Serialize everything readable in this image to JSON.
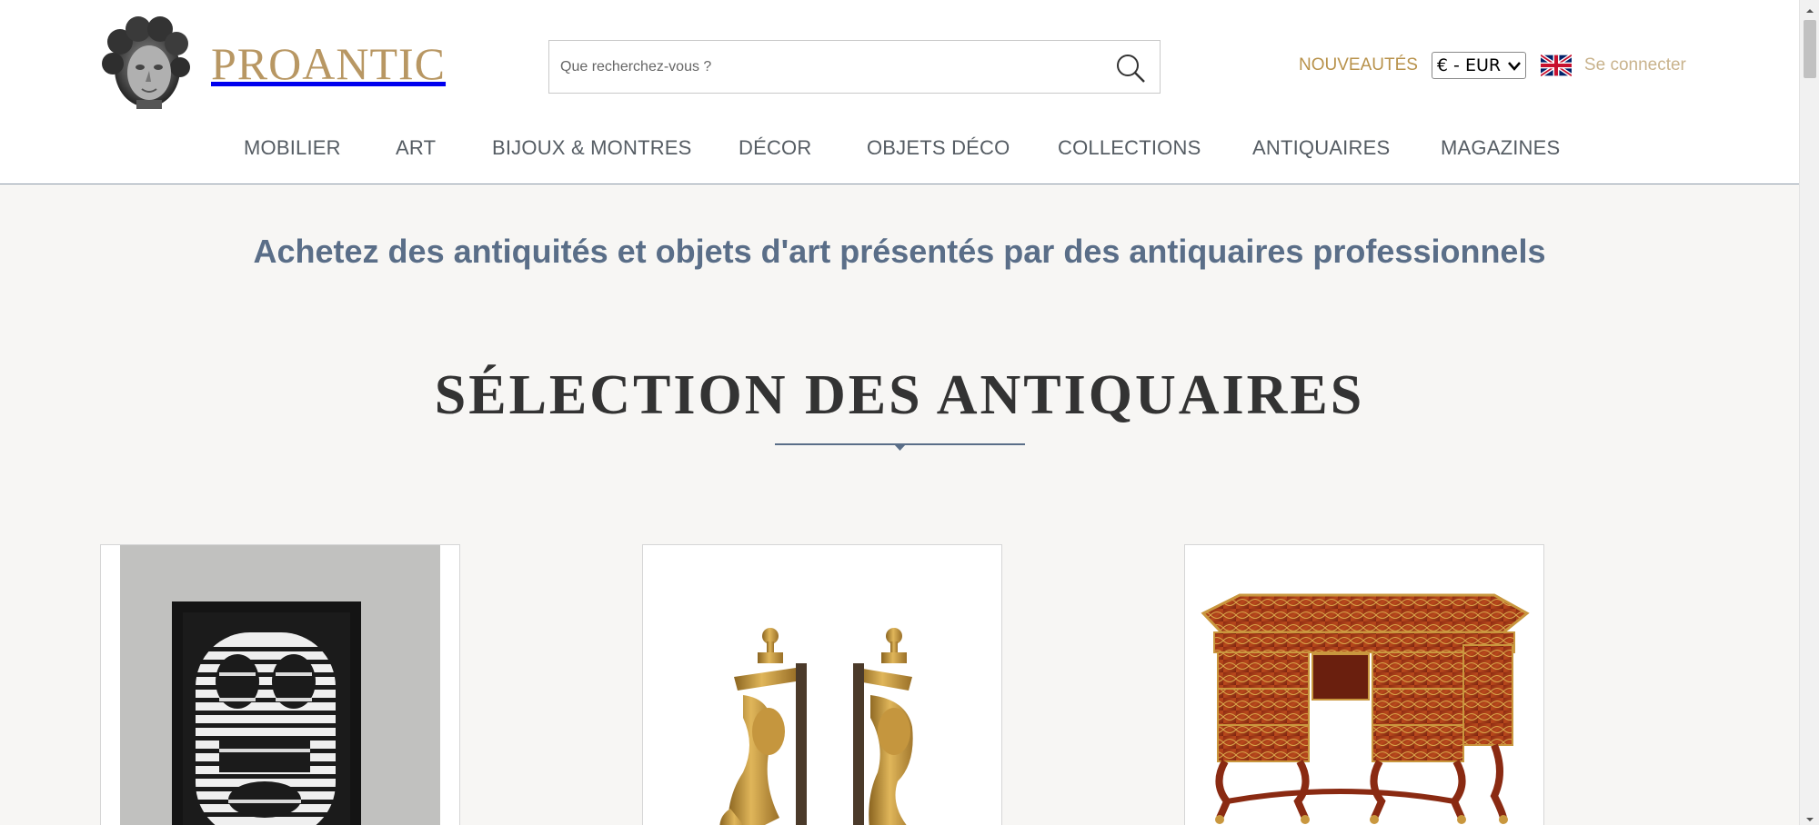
{
  "site": {
    "name": "PROANTIC"
  },
  "search": {
    "placeholder": "Que recherchez-vous ?"
  },
  "header": {
    "new_label": "NOUVEAUTÉS",
    "currency": "€ - EUR",
    "language_flag": "uk-flag-icon",
    "login_label": "Se connecter"
  },
  "nav": {
    "items": [
      {
        "label": "MOBILIER"
      },
      {
        "label": "ART"
      },
      {
        "label": "BIJOUX & MONTRES"
      },
      {
        "label": "DÉCOR"
      },
      {
        "label": "OBJETS DÉCO"
      },
      {
        "label": "COLLECTIONS"
      },
      {
        "label": "ANTIQUAIRES"
      },
      {
        "label": "MAGAZINES"
      }
    ]
  },
  "main": {
    "tagline": "Achetez des antiquités et objets d'art présentés par des antiquaires professionnels",
    "section_title": "SÉLECTION DES ANTIQUAIRES",
    "cards": [
      {
        "image": "op-art-framed-print"
      },
      {
        "image": "gilt-bronze-andirons"
      },
      {
        "image": "boulle-marquetry-desk"
      }
    ]
  },
  "colors": {
    "brand_gold": "#b89763",
    "nav_text": "#555c63",
    "tagline_blue": "#5a6e88"
  }
}
